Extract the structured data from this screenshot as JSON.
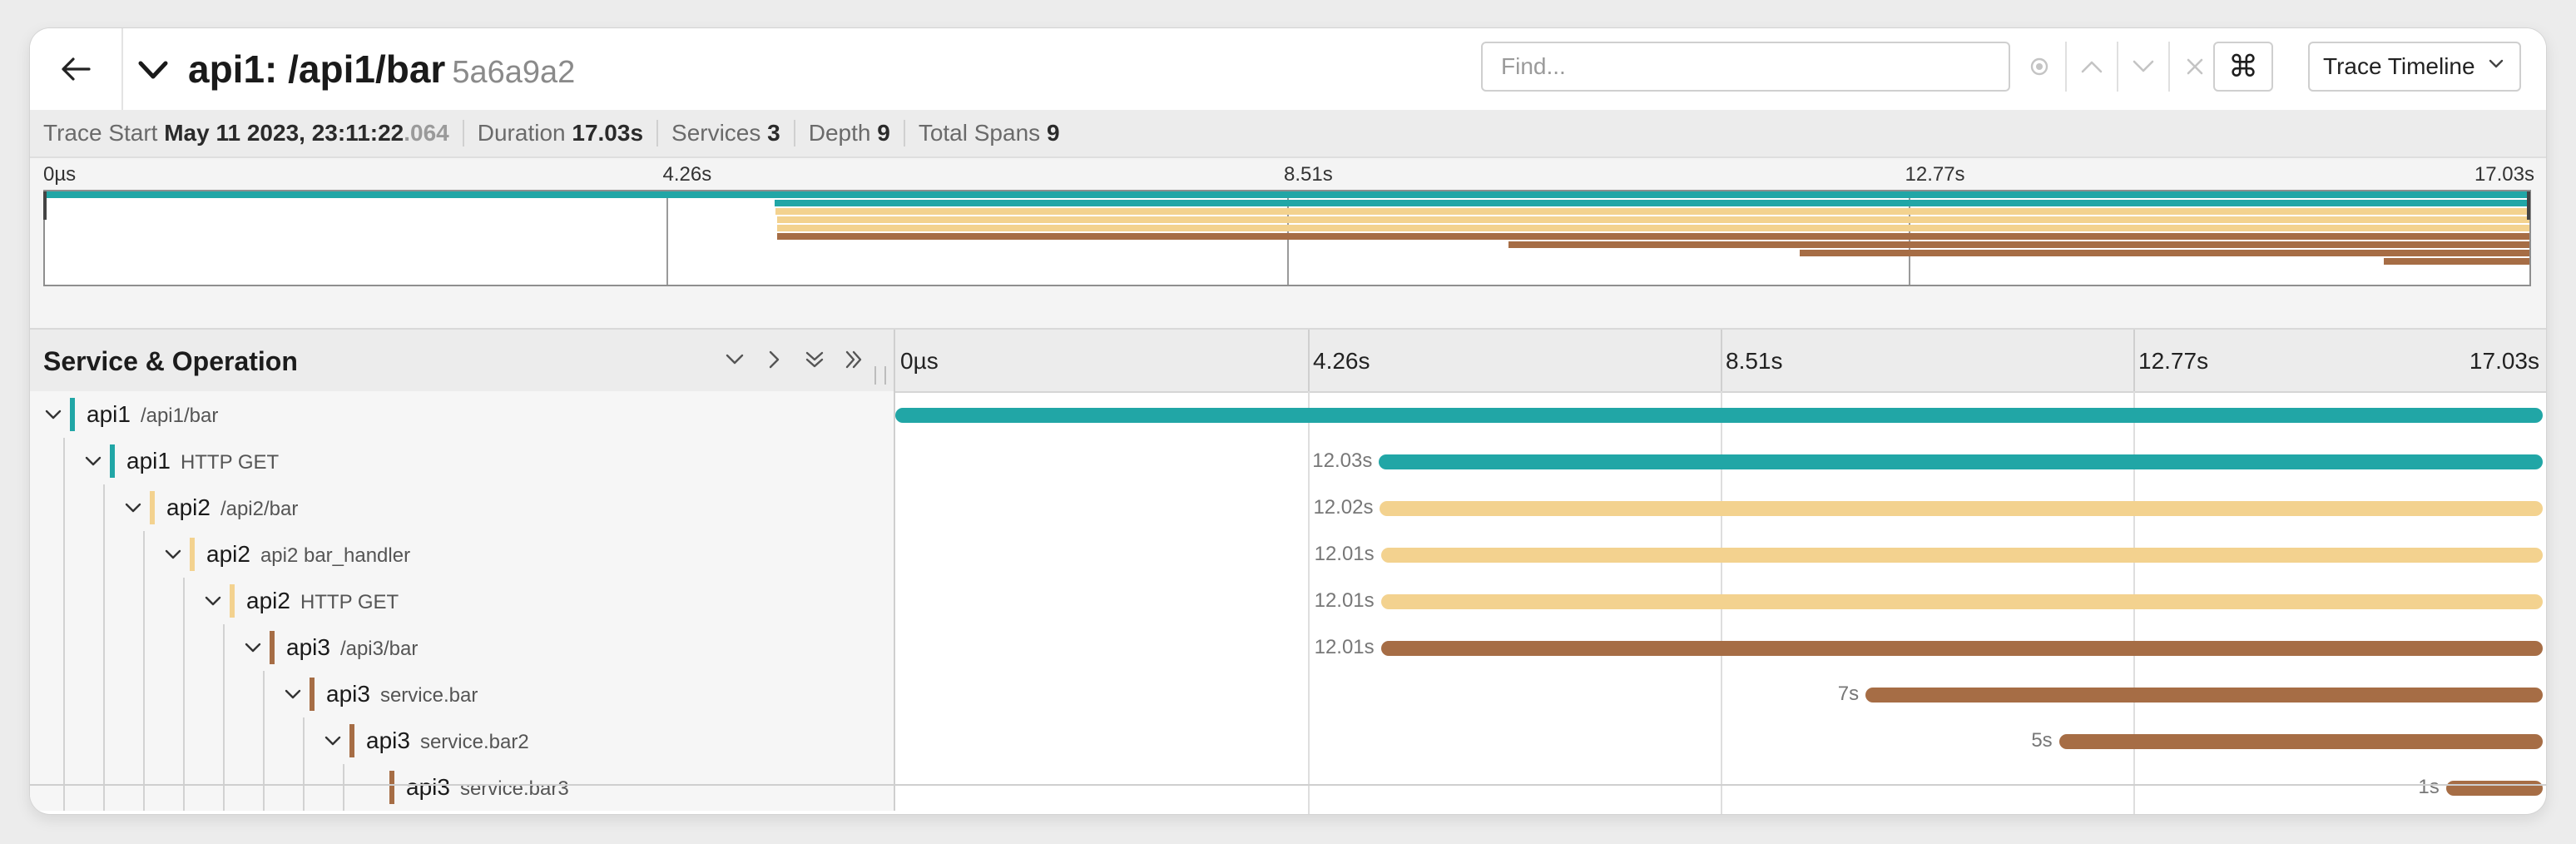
{
  "header": {
    "title": "api1: /api1/bar",
    "trace_id": "5a6a9a2",
    "find_placeholder": "Find...",
    "view_label": "Trace Timeline"
  },
  "summary": {
    "trace_start_label": "Trace Start",
    "trace_start_value": "May 11 2023, 23:11:22",
    "trace_start_ms": ".064",
    "duration_label": "Duration",
    "duration_value": "17.03s",
    "services_label": "Services",
    "services_value": "3",
    "depth_label": "Depth",
    "depth_value": "9",
    "spans_label": "Total Spans",
    "spans_value": "9"
  },
  "ticks": [
    "0µs",
    "4.26s",
    "8.51s",
    "12.77s",
    "17.03s"
  ],
  "columns": {
    "service_operation": "Service & Operation"
  },
  "colors": {
    "api1": "#21a6a6",
    "api2": "#f3d28f",
    "api3": "#a66d45"
  },
  "spans": [
    {
      "service": "api1",
      "operation": "/api1/bar",
      "depth": 0,
      "start": 0.0,
      "end": 17.03,
      "duration": ""
    },
    {
      "service": "api1",
      "operation": "HTTP GET",
      "depth": 1,
      "start": 5.0,
      "end": 17.03,
      "duration": "12.03s"
    },
    {
      "service": "api2",
      "operation": "/api2/bar",
      "depth": 2,
      "start": 5.01,
      "end": 17.03,
      "duration": "12.02s"
    },
    {
      "service": "api2",
      "operation": "api2 bar_handler",
      "depth": 3,
      "start": 5.02,
      "end": 17.03,
      "duration": "12.01s"
    },
    {
      "service": "api2",
      "operation": "HTTP GET",
      "depth": 4,
      "start": 5.02,
      "end": 17.03,
      "duration": "12.01s"
    },
    {
      "service": "api3",
      "operation": "/api3/bar",
      "depth": 5,
      "start": 5.02,
      "end": 17.03,
      "duration": "12.01s"
    },
    {
      "service": "api3",
      "operation": "service.bar",
      "depth": 6,
      "start": 10.03,
      "end": 17.03,
      "duration": "7s"
    },
    {
      "service": "api3",
      "operation": "service.bar2",
      "depth": 7,
      "start": 12.03,
      "end": 17.03,
      "duration": "5s"
    },
    {
      "service": "api3",
      "operation": "service.bar3",
      "depth": 8,
      "start": 16.03,
      "end": 17.03,
      "duration": "1s"
    }
  ],
  "total_duration_s": 17.03
}
